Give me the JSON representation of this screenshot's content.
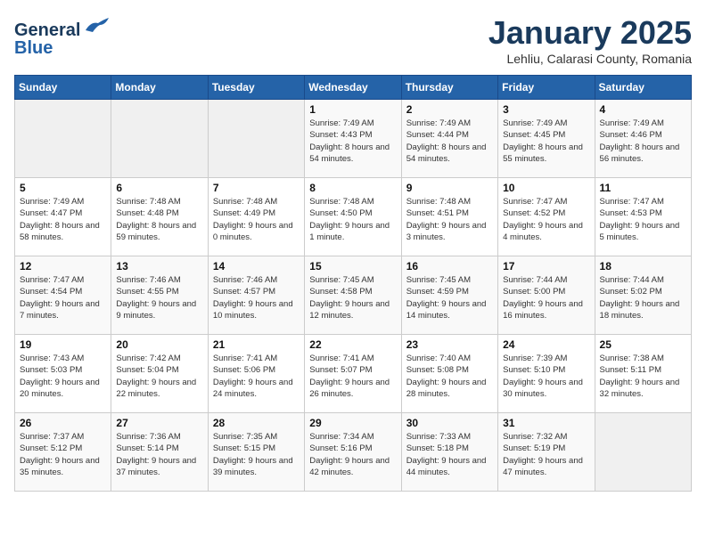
{
  "header": {
    "logo_general": "General",
    "logo_blue": "Blue",
    "month_title": "January 2025",
    "subtitle": "Lehliu, Calarasi County, Romania"
  },
  "weekdays": [
    "Sunday",
    "Monday",
    "Tuesday",
    "Wednesday",
    "Thursday",
    "Friday",
    "Saturday"
  ],
  "weeks": [
    [
      {
        "day": "",
        "empty": true
      },
      {
        "day": "",
        "empty": true
      },
      {
        "day": "",
        "empty": true
      },
      {
        "day": "1",
        "sunrise": "Sunrise: 7:49 AM",
        "sunset": "Sunset: 4:43 PM",
        "daylight": "Daylight: 8 hours and 54 minutes."
      },
      {
        "day": "2",
        "sunrise": "Sunrise: 7:49 AM",
        "sunset": "Sunset: 4:44 PM",
        "daylight": "Daylight: 8 hours and 54 minutes."
      },
      {
        "day": "3",
        "sunrise": "Sunrise: 7:49 AM",
        "sunset": "Sunset: 4:45 PM",
        "daylight": "Daylight: 8 hours and 55 minutes."
      },
      {
        "day": "4",
        "sunrise": "Sunrise: 7:49 AM",
        "sunset": "Sunset: 4:46 PM",
        "daylight": "Daylight: 8 hours and 56 minutes."
      }
    ],
    [
      {
        "day": "5",
        "sunrise": "Sunrise: 7:49 AM",
        "sunset": "Sunset: 4:47 PM",
        "daylight": "Daylight: 8 hours and 58 minutes."
      },
      {
        "day": "6",
        "sunrise": "Sunrise: 7:48 AM",
        "sunset": "Sunset: 4:48 PM",
        "daylight": "Daylight: 8 hours and 59 minutes."
      },
      {
        "day": "7",
        "sunrise": "Sunrise: 7:48 AM",
        "sunset": "Sunset: 4:49 PM",
        "daylight": "Daylight: 9 hours and 0 minutes."
      },
      {
        "day": "8",
        "sunrise": "Sunrise: 7:48 AM",
        "sunset": "Sunset: 4:50 PM",
        "daylight": "Daylight: 9 hours and 1 minute."
      },
      {
        "day": "9",
        "sunrise": "Sunrise: 7:48 AM",
        "sunset": "Sunset: 4:51 PM",
        "daylight": "Daylight: 9 hours and 3 minutes."
      },
      {
        "day": "10",
        "sunrise": "Sunrise: 7:47 AM",
        "sunset": "Sunset: 4:52 PM",
        "daylight": "Daylight: 9 hours and 4 minutes."
      },
      {
        "day": "11",
        "sunrise": "Sunrise: 7:47 AM",
        "sunset": "Sunset: 4:53 PM",
        "daylight": "Daylight: 9 hours and 5 minutes."
      }
    ],
    [
      {
        "day": "12",
        "sunrise": "Sunrise: 7:47 AM",
        "sunset": "Sunset: 4:54 PM",
        "daylight": "Daylight: 9 hours and 7 minutes."
      },
      {
        "day": "13",
        "sunrise": "Sunrise: 7:46 AM",
        "sunset": "Sunset: 4:55 PM",
        "daylight": "Daylight: 9 hours and 9 minutes."
      },
      {
        "day": "14",
        "sunrise": "Sunrise: 7:46 AM",
        "sunset": "Sunset: 4:57 PM",
        "daylight": "Daylight: 9 hours and 10 minutes."
      },
      {
        "day": "15",
        "sunrise": "Sunrise: 7:45 AM",
        "sunset": "Sunset: 4:58 PM",
        "daylight": "Daylight: 9 hours and 12 minutes."
      },
      {
        "day": "16",
        "sunrise": "Sunrise: 7:45 AM",
        "sunset": "Sunset: 4:59 PM",
        "daylight": "Daylight: 9 hours and 14 minutes."
      },
      {
        "day": "17",
        "sunrise": "Sunrise: 7:44 AM",
        "sunset": "Sunset: 5:00 PM",
        "daylight": "Daylight: 9 hours and 16 minutes."
      },
      {
        "day": "18",
        "sunrise": "Sunrise: 7:44 AM",
        "sunset": "Sunset: 5:02 PM",
        "daylight": "Daylight: 9 hours and 18 minutes."
      }
    ],
    [
      {
        "day": "19",
        "sunrise": "Sunrise: 7:43 AM",
        "sunset": "Sunset: 5:03 PM",
        "daylight": "Daylight: 9 hours and 20 minutes."
      },
      {
        "day": "20",
        "sunrise": "Sunrise: 7:42 AM",
        "sunset": "Sunset: 5:04 PM",
        "daylight": "Daylight: 9 hours and 22 minutes."
      },
      {
        "day": "21",
        "sunrise": "Sunrise: 7:41 AM",
        "sunset": "Sunset: 5:06 PM",
        "daylight": "Daylight: 9 hours and 24 minutes."
      },
      {
        "day": "22",
        "sunrise": "Sunrise: 7:41 AM",
        "sunset": "Sunset: 5:07 PM",
        "daylight": "Daylight: 9 hours and 26 minutes."
      },
      {
        "day": "23",
        "sunrise": "Sunrise: 7:40 AM",
        "sunset": "Sunset: 5:08 PM",
        "daylight": "Daylight: 9 hours and 28 minutes."
      },
      {
        "day": "24",
        "sunrise": "Sunrise: 7:39 AM",
        "sunset": "Sunset: 5:10 PM",
        "daylight": "Daylight: 9 hours and 30 minutes."
      },
      {
        "day": "25",
        "sunrise": "Sunrise: 7:38 AM",
        "sunset": "Sunset: 5:11 PM",
        "daylight": "Daylight: 9 hours and 32 minutes."
      }
    ],
    [
      {
        "day": "26",
        "sunrise": "Sunrise: 7:37 AM",
        "sunset": "Sunset: 5:12 PM",
        "daylight": "Daylight: 9 hours and 35 minutes."
      },
      {
        "day": "27",
        "sunrise": "Sunrise: 7:36 AM",
        "sunset": "Sunset: 5:14 PM",
        "daylight": "Daylight: 9 hours and 37 minutes."
      },
      {
        "day": "28",
        "sunrise": "Sunrise: 7:35 AM",
        "sunset": "Sunset: 5:15 PM",
        "daylight": "Daylight: 9 hours and 39 minutes."
      },
      {
        "day": "29",
        "sunrise": "Sunrise: 7:34 AM",
        "sunset": "Sunset: 5:16 PM",
        "daylight": "Daylight: 9 hours and 42 minutes."
      },
      {
        "day": "30",
        "sunrise": "Sunrise: 7:33 AM",
        "sunset": "Sunset: 5:18 PM",
        "daylight": "Daylight: 9 hours and 44 minutes."
      },
      {
        "day": "31",
        "sunrise": "Sunrise: 7:32 AM",
        "sunset": "Sunset: 5:19 PM",
        "daylight": "Daylight: 9 hours and 47 minutes."
      },
      {
        "day": "",
        "empty": true
      }
    ]
  ]
}
